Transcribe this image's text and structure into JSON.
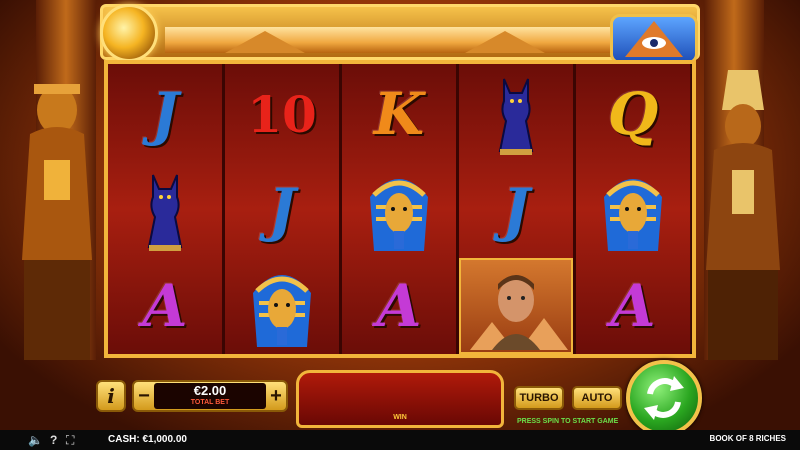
{
  "game": {
    "name": "BOOK OF 8 RICHES"
  },
  "reels": [
    [
      {
        "kind": "letter",
        "text": "J",
        "color": "#2b7ad6"
      },
      {
        "kind": "cat"
      },
      {
        "kind": "letter",
        "text": "A",
        "color": "#c43ad6"
      }
    ],
    [
      {
        "kind": "ten",
        "text": "10",
        "color": "#e8231a"
      },
      {
        "kind": "letter",
        "text": "J",
        "color": "#2b7ad6"
      },
      {
        "kind": "pharaoh"
      }
    ],
    [
      {
        "kind": "letter",
        "text": "K",
        "color": "#f08a1a"
      },
      {
        "kind": "pharaoh"
      },
      {
        "kind": "letter",
        "text": "A",
        "color": "#c43ad6"
      }
    ],
    [
      {
        "kind": "cat"
      },
      {
        "kind": "letter",
        "text": "J",
        "color": "#2b7ad6"
      },
      {
        "kind": "explorer"
      }
    ],
    [
      {
        "kind": "letter",
        "text": "Q",
        "color": "#f0b81a"
      },
      {
        "kind": "pharaoh"
      },
      {
        "kind": "letter",
        "text": "A",
        "color": "#c43ad6"
      }
    ]
  ],
  "controls": {
    "info_label": "i",
    "bet_minus": "−",
    "bet_plus": "+",
    "bet_value": "€2.00",
    "bet_label": "TOTAL BET",
    "win_label": "WIN",
    "turbo_label": "TURBO",
    "auto_label": "AUTO",
    "spin_icon": "refresh-arrows-icon"
  },
  "status": {
    "cash_label": "CASH:",
    "cash_value": "€1,000.00",
    "hint": "PRESS SPIN TO START GAME",
    "sound_icon": "🔈",
    "help_icon": "?",
    "fullscreen_icon": "⛶"
  },
  "colors": {
    "frame_gold": "#f2b53b",
    "reel_red": "#a81f10",
    "spin_green": "#2aa620",
    "hint_green": "#6be04a",
    "bet_label_red": "#ff5a3a"
  }
}
